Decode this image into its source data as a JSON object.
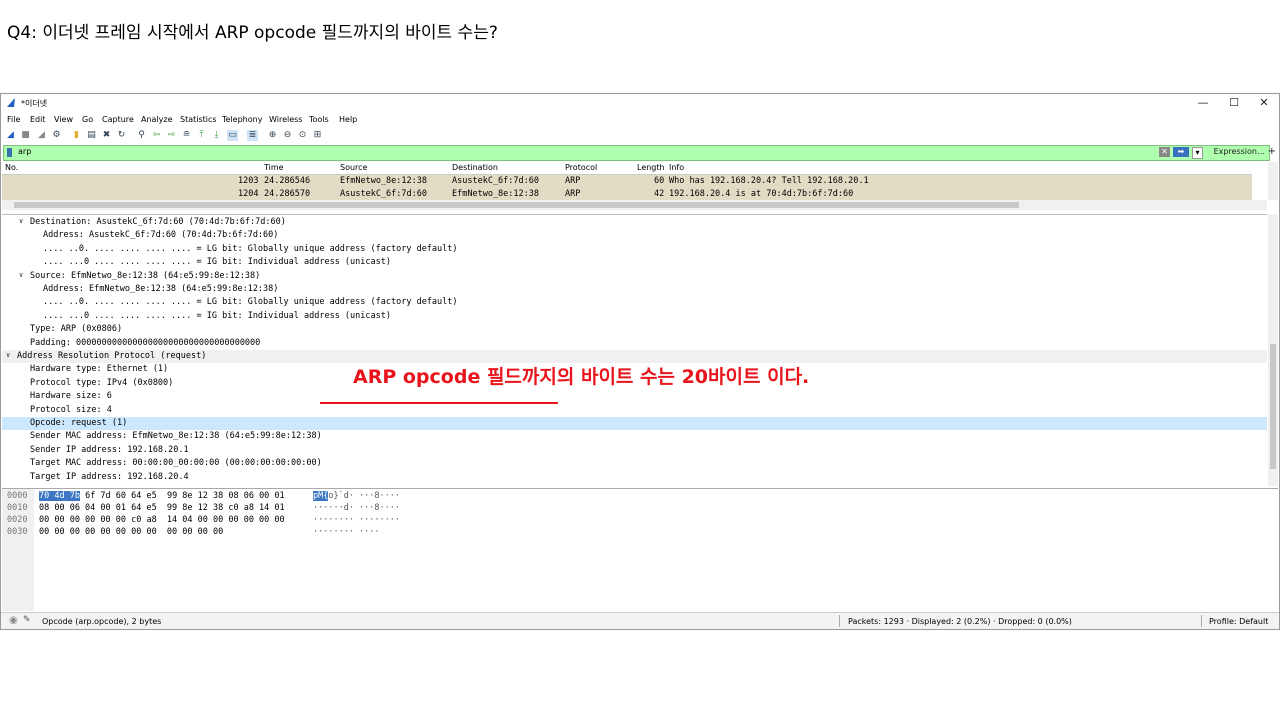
{
  "slide": {
    "title": "Q4: 이더넷 프레임 시작에서 ARP opcode 필드까지의 바이트 수는?",
    "annotation": "ARP opcode 필드까지의 바이트 수는 20바이트 이다."
  },
  "window": {
    "title": "*이더넷",
    "minimize": "—",
    "maximize": "☐",
    "close": "✕"
  },
  "menu": [
    "File",
    "Edit",
    "View",
    "Go",
    "Capture",
    "Analyze",
    "Statistics",
    "Telephony",
    "Wireless",
    "Tools",
    "Help"
  ],
  "filter": {
    "value": "arp",
    "clear": "✕",
    "apply": "➡",
    "dropdown": "▾",
    "expression": "Expression…",
    "add": "+"
  },
  "packet_list": {
    "headers": [
      "No.",
      "Time",
      "Source",
      "Destination",
      "Protocol",
      "Length",
      "Info"
    ],
    "rows": [
      {
        "no": "1203",
        "time": "24.286546",
        "source": "EfmNetwo_8e:12:38",
        "destination": "AsustekC_6f:7d:60",
        "protocol": "ARP",
        "length": "60",
        "info": "Who has 192.168.20.4? Tell 192.168.20.1"
      },
      {
        "no": "1204",
        "time": "24.286570",
        "source": "AsustekC_6f:7d:60",
        "destination": "EfmNetwo_8e:12:38",
        "protocol": "ARP",
        "length": "42",
        "info": "192.168.20.4 is at 70:4d:7b:6f:7d:60"
      }
    ]
  },
  "details": [
    {
      "indent": 1,
      "arrow": "∨",
      "text": "Destination: AsustekC_6f:7d:60 (70:4d:7b:6f:7d:60)"
    },
    {
      "indent": 2,
      "arrow": "",
      "text": "Address: AsustekC_6f:7d:60 (70:4d:7b:6f:7d:60)"
    },
    {
      "indent": 2,
      "arrow": "",
      "text": ".... ..0. .... .... .... .... = LG bit: Globally unique address (factory default)"
    },
    {
      "indent": 2,
      "arrow": "",
      "text": ".... ...0 .... .... .... .... = IG bit: Individual address (unicast)"
    },
    {
      "indent": 1,
      "arrow": "∨",
      "text": "Source: EfmNetwo_8e:12:38 (64:e5:99:8e:12:38)"
    },
    {
      "indent": 2,
      "arrow": "",
      "text": "Address: EfmNetwo_8e:12:38 (64:e5:99:8e:12:38)"
    },
    {
      "indent": 2,
      "arrow": "",
      "text": ".... ..0. .... .... .... .... = LG bit: Globally unique address (factory default)"
    },
    {
      "indent": 2,
      "arrow": "",
      "text": ".... ...0 .... .... .... .... = IG bit: Individual address (unicast)"
    },
    {
      "indent": 1,
      "arrow": "",
      "text": "Type: ARP (0x0806)"
    },
    {
      "indent": 1,
      "arrow": "",
      "text": "Padding: 000000000000000000000000000000000000"
    },
    {
      "indent": 0,
      "arrow": "∨",
      "text": "Address Resolution Protocol (request)",
      "section": true
    },
    {
      "indent": 1,
      "arrow": "",
      "text": "Hardware type: Ethernet (1)"
    },
    {
      "indent": 1,
      "arrow": "",
      "text": "Protocol type: IPv4 (0x0800)"
    },
    {
      "indent": 1,
      "arrow": "",
      "text": "Hardware size: 6"
    },
    {
      "indent": 1,
      "arrow": "",
      "text": "Protocol size: 4"
    },
    {
      "indent": 1,
      "arrow": "",
      "text": "Opcode: request (1)",
      "selected": true
    },
    {
      "indent": 1,
      "arrow": "",
      "text": "Sender MAC address: EfmNetwo_8e:12:38 (64:e5:99:8e:12:38)"
    },
    {
      "indent": 1,
      "arrow": "",
      "text": "Sender IP address: 192.168.20.1"
    },
    {
      "indent": 1,
      "arrow": "",
      "text": "Target MAC address: 00:00:00_00:00:00 (00:00:00:00:00:00)"
    },
    {
      "indent": 1,
      "arrow": "",
      "text": "Target IP address: 192.168.20.4"
    }
  ],
  "hex": [
    {
      "offset": "0000",
      "sel": "70 4d 7b",
      "bytes": " 6f 7d 60 64 e5  99 8e 12 38 08 06 00 01",
      "ascii_sel": "pM{",
      "ascii": "o}`d· ···8····"
    },
    {
      "offset": "0010",
      "sel": "",
      "bytes": "08 00 06 04 00 01 64 e5  99 8e 12 38 c0 a8 14 01",
      "ascii_sel": "",
      "ascii": "······d· ···8····"
    },
    {
      "offset": "0020",
      "sel": "",
      "bytes": "00 00 00 00 00 00 c0 a8  14 04 00 00 00 00 00 00",
      "ascii_sel": "",
      "ascii": "········ ········"
    },
    {
      "offset": "0030",
      "sel": "",
      "bytes": "00 00 00 00 00 00 00 00  00 00 00 00",
      "ascii_sel": "",
      "ascii": "········ ····"
    }
  ],
  "status": {
    "field": "Opcode (arp.opcode), 2 bytes",
    "packets": "Packets: 1293 · Displayed: 2 (0.2%) · Dropped: 0 (0.0%)",
    "profile": "Profile: Default"
  },
  "colors": {
    "filter_bg": "#afffaf",
    "row_bg": "#e3dcc4",
    "selected_detail": "#cce8ff",
    "annotation": "#e8141c"
  }
}
